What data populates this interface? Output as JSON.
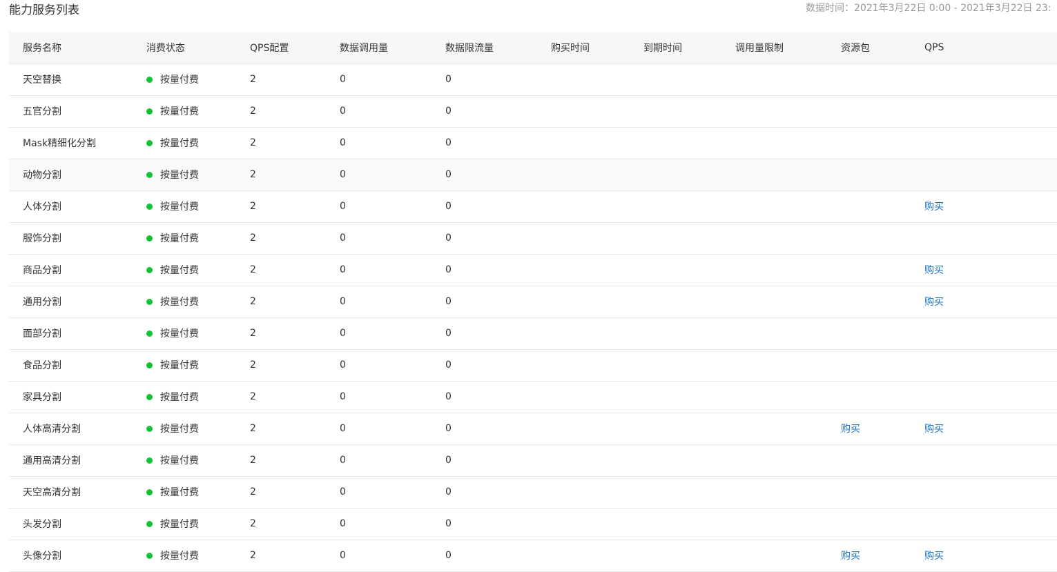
{
  "page": {
    "title": "能力服务列表",
    "data_time": "数据时间：2021年3月22日 0:00 - 2021年3月22日 23:"
  },
  "colors": {
    "status_active": "#13c235",
    "link": "#1f75c8"
  },
  "table": {
    "headers": [
      "服务名称",
      "消费状态",
      "QPS配置",
      "数据调用量",
      "数据限流量",
      "购买时间",
      "到期时间",
      "调用量限制",
      "资源包",
      "QPS"
    ],
    "rows": [
      {
        "name": "天空替换",
        "status": "按量付费",
        "qps_config": "2",
        "calls": "0",
        "throttled": "0",
        "buy_time": "",
        "expire_time": "",
        "call_limit": "",
        "pack": "",
        "qps": ""
      },
      {
        "name": "五官分割",
        "status": "按量付费",
        "qps_config": "2",
        "calls": "0",
        "throttled": "0",
        "buy_time": "",
        "expire_time": "",
        "call_limit": "",
        "pack": "",
        "qps": ""
      },
      {
        "name": "Mask精细化分割",
        "status": "按量付费",
        "qps_config": "2",
        "calls": "0",
        "throttled": "0",
        "buy_time": "",
        "expire_time": "",
        "call_limit": "",
        "pack": "",
        "qps": ""
      },
      {
        "name": "动物分割",
        "status": "按量付费",
        "qps_config": "2",
        "calls": "0",
        "throttled": "0",
        "buy_time": "",
        "expire_time": "",
        "call_limit": "",
        "pack": "",
        "qps": ""
      },
      {
        "name": "人体分割",
        "status": "按量付费",
        "qps_config": "2",
        "calls": "0",
        "throttled": "0",
        "buy_time": "",
        "expire_time": "",
        "call_limit": "",
        "pack": "",
        "qps": "购买"
      },
      {
        "name": "服饰分割",
        "status": "按量付费",
        "qps_config": "2",
        "calls": "0",
        "throttled": "0",
        "buy_time": "",
        "expire_time": "",
        "call_limit": "",
        "pack": "",
        "qps": ""
      },
      {
        "name": "商品分割",
        "status": "按量付费",
        "qps_config": "2",
        "calls": "0",
        "throttled": "0",
        "buy_time": "",
        "expire_time": "",
        "call_limit": "",
        "pack": "",
        "qps": "购买"
      },
      {
        "name": "通用分割",
        "status": "按量付费",
        "qps_config": "2",
        "calls": "0",
        "throttled": "0",
        "buy_time": "",
        "expire_time": "",
        "call_limit": "",
        "pack": "",
        "qps": "购买"
      },
      {
        "name": "面部分割",
        "status": "按量付费",
        "qps_config": "2",
        "calls": "0",
        "throttled": "0",
        "buy_time": "",
        "expire_time": "",
        "call_limit": "",
        "pack": "",
        "qps": ""
      },
      {
        "name": "食品分割",
        "status": "按量付费",
        "qps_config": "2",
        "calls": "0",
        "throttled": "0",
        "buy_time": "",
        "expire_time": "",
        "call_limit": "",
        "pack": "",
        "qps": ""
      },
      {
        "name": "家具分割",
        "status": "按量付费",
        "qps_config": "2",
        "calls": "0",
        "throttled": "0",
        "buy_time": "",
        "expire_time": "",
        "call_limit": "",
        "pack": "",
        "qps": ""
      },
      {
        "name": "人体高清分割",
        "status": "按量付费",
        "qps_config": "2",
        "calls": "0",
        "throttled": "0",
        "buy_time": "",
        "expire_time": "",
        "call_limit": "",
        "pack": "购买",
        "qps": "购买"
      },
      {
        "name": "通用高清分割",
        "status": "按量付费",
        "qps_config": "2",
        "calls": "0",
        "throttled": "0",
        "buy_time": "",
        "expire_time": "",
        "call_limit": "",
        "pack": "",
        "qps": ""
      },
      {
        "name": "天空高清分割",
        "status": "按量付费",
        "qps_config": "2",
        "calls": "0",
        "throttled": "0",
        "buy_time": "",
        "expire_time": "",
        "call_limit": "",
        "pack": "",
        "qps": ""
      },
      {
        "name": "头发分割",
        "status": "按量付费",
        "qps_config": "2",
        "calls": "0",
        "throttled": "0",
        "buy_time": "",
        "expire_time": "",
        "call_limit": "",
        "pack": "",
        "qps": ""
      },
      {
        "name": "头像分割",
        "status": "按量付费",
        "qps_config": "2",
        "calls": "0",
        "throttled": "0",
        "buy_time": "",
        "expire_time": "",
        "call_limit": "",
        "pack": "购买",
        "qps": "购买"
      }
    ]
  }
}
